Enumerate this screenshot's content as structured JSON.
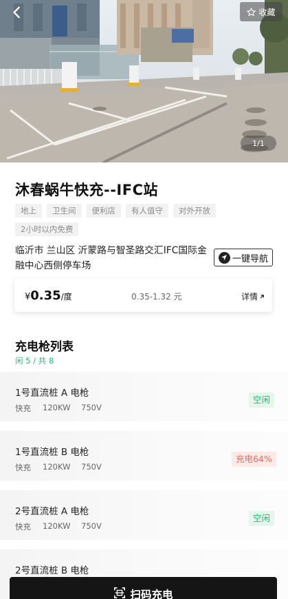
{
  "hero": {
    "favorite_label": "收藏",
    "pager_text": "1/1",
    "icons": {
      "back": "back-arrow-icon",
      "favorite": "star-icon"
    }
  },
  "station": {
    "name": "沐春蜗牛快充--IFC站",
    "tags": [
      "地上",
      "卫生间",
      "便利店",
      "有人值守",
      "对外开放",
      "2小时以内免费"
    ],
    "address": "临沂市 兰山区 沂蒙路与智圣路交汇IFC国际金融中心西侧停车场",
    "nav_label": "一键导航"
  },
  "price": {
    "currency": "¥",
    "value": "0.35",
    "unit": "/度",
    "range": "0.35-1.32 元",
    "detail_label": "详情"
  },
  "gun_list": {
    "title": "充电枪列表",
    "summary": "闲 5 / 共 8",
    "items": [
      {
        "name": "1号直流桩 A 电枪",
        "type": "快充",
        "power": "120KW",
        "voltage": "750V",
        "status": "空闲",
        "state": "idle"
      },
      {
        "name": "1号直流桩 B 电枪",
        "type": "快充",
        "power": "120KW",
        "voltage": "750V",
        "status": "充电64%",
        "state": "charging"
      },
      {
        "name": "2号直流桩 A 电枪",
        "type": "快充",
        "power": "120KW",
        "voltage": "750V",
        "status": "空闲",
        "state": "idle"
      },
      {
        "name": "2号直流桩 B 电枪",
        "type": "",
        "power": "",
        "voltage": "",
        "status": "",
        "state": ""
      }
    ]
  },
  "bottom": {
    "scan_label": "扫码充电",
    "icon": "scan-icon"
  },
  "colors": {
    "idle": "#2cb673",
    "charging": "#f26b5b",
    "button_dark": "#151515"
  }
}
